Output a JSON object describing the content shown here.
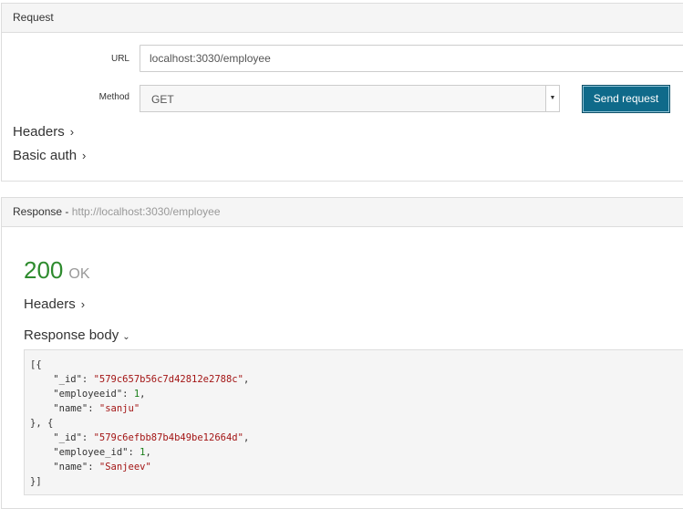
{
  "request": {
    "heading": "Request",
    "url_label": "URL",
    "url_value": "localhost:3030/employee",
    "method_label": "Method",
    "method_value": "GET",
    "send_label": "Send request",
    "headers_label": "Headers",
    "basic_auth_label": "Basic auth"
  },
  "response": {
    "heading": "Response -",
    "url": "http://localhost:3030/employee",
    "status_code": "200",
    "status_text": "OK",
    "headers_label": "Headers",
    "body_label": "Response body",
    "body": {
      "line1": "[{",
      "line2_key": "\"_id\"",
      "line2_val": "\"579c657b56c7d42812e2788c\"",
      "line3_key": "\"employeeid\"",
      "line3_val": "1",
      "line4_key": "\"name\"",
      "line4_val": "\"sanju\"",
      "line5": "}, {",
      "line6_key": "\"_id\"",
      "line6_val": "\"579c6efbb87b4b49be12664d\"",
      "line7_key": "\"employee_id\"",
      "line7_val": "1",
      "line8_key": "\"name\"",
      "line8_val": "\"Sanjeev\"",
      "line9": "}]"
    }
  },
  "colors": {
    "send_button": "#0f6a8a",
    "status_ok": "#2e8b2e",
    "json_string": "#a31515",
    "json_number": "#1a7f1a"
  },
  "icons": {
    "expand": "chevron-right-icon",
    "collapse": "chevron-down-icon",
    "select": "caret-down-icon"
  }
}
